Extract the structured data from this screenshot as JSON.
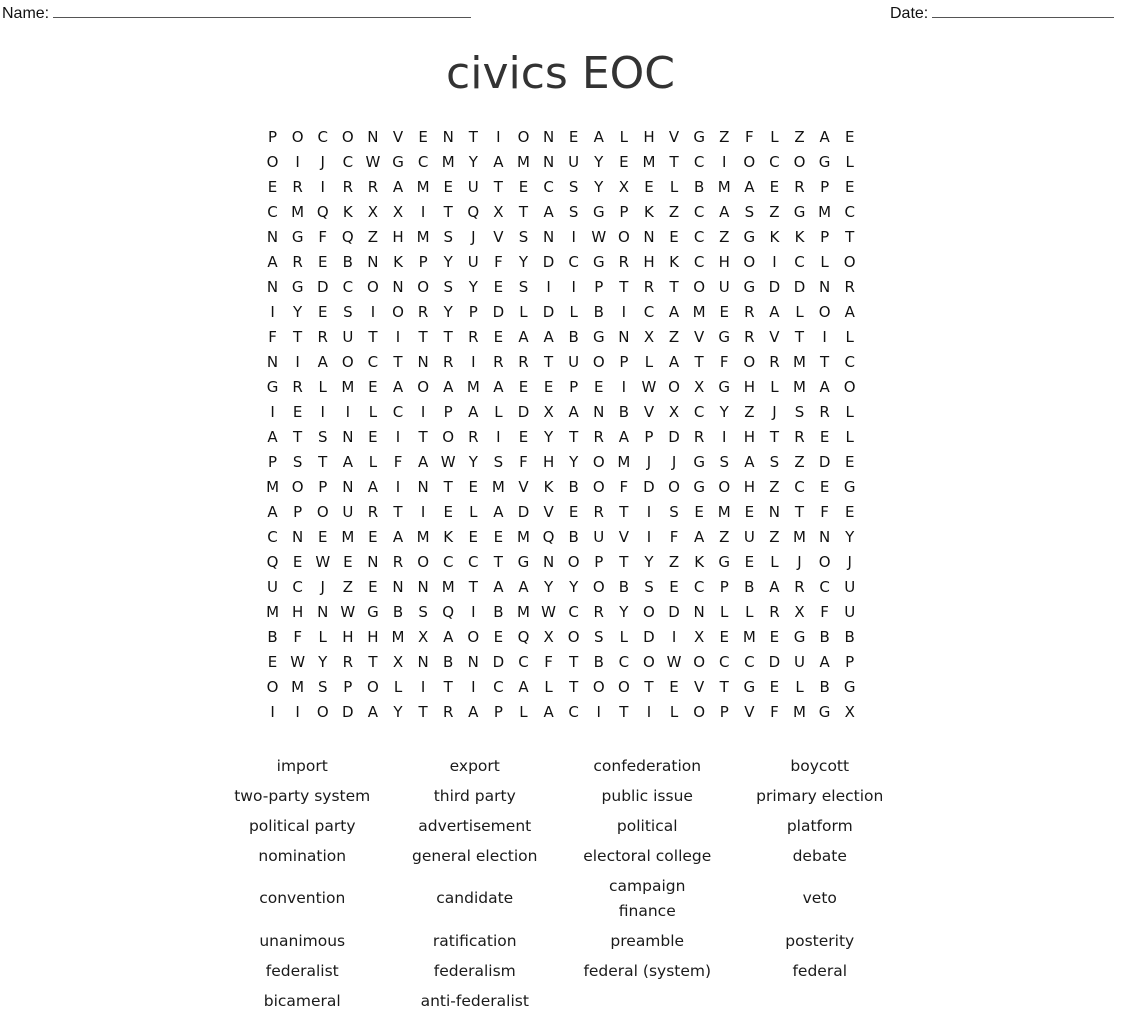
{
  "header": {
    "name_label": "Name:",
    "date_label": "Date:"
  },
  "title": "civics EOC",
  "grid": [
    [
      "P",
      "O",
      "C",
      "O",
      "N",
      "V",
      "E",
      "N",
      "T",
      "I",
      "O",
      "N",
      "E",
      "A",
      "L",
      "H",
      "V",
      "G",
      "Z",
      "F",
      "L",
      "Z",
      "A",
      "E"
    ],
    [
      "O",
      "I",
      "J",
      "C",
      "W",
      "G",
      "C",
      "M",
      "Y",
      "A",
      "M",
      "N",
      "U",
      "Y",
      "E",
      "M",
      "T",
      "C",
      "I",
      "O",
      "C",
      "O",
      "G",
      "L"
    ],
    [
      "E",
      "R",
      "I",
      "R",
      "R",
      "A",
      "M",
      "E",
      "U",
      "T",
      "E",
      "C",
      "S",
      "Y",
      "X",
      "E",
      "L",
      "B",
      "M",
      "A",
      "E",
      "R",
      "P",
      "E"
    ],
    [
      "C",
      "M",
      "Q",
      "K",
      "X",
      "X",
      "I",
      "T",
      "Q",
      "X",
      "T",
      "A",
      "S",
      "G",
      "P",
      "K",
      "Z",
      "C",
      "A",
      "S",
      "Z",
      "G",
      "M",
      "C"
    ],
    [
      "N",
      "G",
      "F",
      "Q",
      "Z",
      "H",
      "M",
      "S",
      "J",
      "V",
      "S",
      "N",
      "I",
      "W",
      "O",
      "N",
      "E",
      "C",
      "Z",
      "G",
      "K",
      "K",
      "P",
      "T"
    ],
    [
      "A",
      "R",
      "E",
      "B",
      "N",
      "K",
      "P",
      "Y",
      "U",
      "F",
      "Y",
      "D",
      "C",
      "G",
      "R",
      "H",
      "K",
      "C",
      "H",
      "O",
      "I",
      "C",
      "L",
      "O"
    ],
    [
      "N",
      "G",
      "D",
      "C",
      "O",
      "N",
      "O",
      "S",
      "Y",
      "E",
      "S",
      "I",
      "I",
      "P",
      "T",
      "R",
      "T",
      "O",
      "U",
      "G",
      "D",
      "D",
      "N",
      "R"
    ],
    [
      "I",
      "Y",
      "E",
      "S",
      "I",
      "O",
      "R",
      "Y",
      "P",
      "D",
      "L",
      "D",
      "L",
      "B",
      "I",
      "C",
      "A",
      "M",
      "E",
      "R",
      "A",
      "L",
      "O",
      "A"
    ],
    [
      "F",
      "T",
      "R",
      "U",
      "T",
      "I",
      "T",
      "T",
      "R",
      "E",
      "A",
      "A",
      "B",
      "G",
      "N",
      "X",
      "Z",
      "V",
      "G",
      "R",
      "V",
      "T",
      "I",
      "L"
    ],
    [
      "N",
      "I",
      "A",
      "O",
      "C",
      "T",
      "N",
      "R",
      "I",
      "R",
      "R",
      "T",
      "U",
      "O",
      "P",
      "L",
      "A",
      "T",
      "F",
      "O",
      "R",
      "M",
      "T",
      "C"
    ],
    [
      "G",
      "R",
      "L",
      "M",
      "E",
      "A",
      "O",
      "A",
      "M",
      "A",
      "E",
      "E",
      "P",
      "E",
      "I",
      "W",
      "O",
      "X",
      "G",
      "H",
      "L",
      "M",
      "A",
      "O"
    ],
    [
      "I",
      "E",
      "I",
      "I",
      "L",
      "C",
      "I",
      "P",
      "A",
      "L",
      "D",
      "X",
      "A",
      "N",
      "B",
      "V",
      "X",
      "C",
      "Y",
      "Z",
      "J",
      "S",
      "R",
      "L"
    ],
    [
      "A",
      "T",
      "S",
      "N",
      "E",
      "I",
      "T",
      "O",
      "R",
      "I",
      "E",
      "Y",
      "T",
      "R",
      "A",
      "P",
      "D",
      "R",
      "I",
      "H",
      "T",
      "R",
      "E",
      "L"
    ],
    [
      "P",
      "S",
      "T",
      "A",
      "L",
      "F",
      "A",
      "W",
      "Y",
      "S",
      "F",
      "H",
      "Y",
      "O",
      "M",
      "J",
      "J",
      "G",
      "S",
      "A",
      "S",
      "Z",
      "D",
      "E"
    ],
    [
      "M",
      "O",
      "P",
      "N",
      "A",
      "I",
      "N",
      "T",
      "E",
      "M",
      "V",
      "K",
      "B",
      "O",
      "F",
      "D",
      "O",
      "G",
      "O",
      "H",
      "Z",
      "C",
      "E",
      "G"
    ],
    [
      "A",
      "P",
      "O",
      "U",
      "R",
      "T",
      "I",
      "E",
      "L",
      "A",
      "D",
      "V",
      "E",
      "R",
      "T",
      "I",
      "S",
      "E",
      "M",
      "E",
      "N",
      "T",
      "F",
      "E"
    ],
    [
      "C",
      "N",
      "E",
      "M",
      "E",
      "A",
      "M",
      "K",
      "E",
      "E",
      "M",
      "Q",
      "B",
      "U",
      "V",
      "I",
      "F",
      "A",
      "Z",
      "U",
      "Z",
      "M",
      "N",
      "Y"
    ],
    [
      "Q",
      "E",
      "W",
      "E",
      "N",
      "R",
      "O",
      "C",
      "C",
      "T",
      "G",
      "N",
      "O",
      "P",
      "T",
      "Y",
      "Z",
      "K",
      "G",
      "E",
      "L",
      "J",
      "O",
      "J"
    ],
    [
      "U",
      "C",
      "J",
      "Z",
      "E",
      "N",
      "N",
      "M",
      "T",
      "A",
      "A",
      "Y",
      "Y",
      "O",
      "B",
      "S",
      "E",
      "C",
      "P",
      "B",
      "A",
      "R",
      "C",
      "U"
    ],
    [
      "M",
      "H",
      "N",
      "W",
      "G",
      "B",
      "S",
      "Q",
      "I",
      "B",
      "M",
      "W",
      "C",
      "R",
      "Y",
      "O",
      "D",
      "N",
      "L",
      "L",
      "R",
      "X",
      "F",
      "U"
    ],
    [
      "B",
      "F",
      "L",
      "H",
      "H",
      "M",
      "X",
      "A",
      "O",
      "E",
      "Q",
      "X",
      "O",
      "S",
      "L",
      "D",
      "I",
      "X",
      "E",
      "M",
      "E",
      "G",
      "B",
      "B"
    ],
    [
      "E",
      "W",
      "Y",
      "R",
      "T",
      "X",
      "N",
      "B",
      "N",
      "D",
      "C",
      "F",
      "T",
      "B",
      "C",
      "O",
      "W",
      "O",
      "C",
      "C",
      "D",
      "U",
      "A",
      "P"
    ],
    [
      "O",
      "M",
      "S",
      "P",
      "O",
      "L",
      "I",
      "T",
      "I",
      "C",
      "A",
      "L",
      "T",
      "O",
      "O",
      "T",
      "E",
      "V",
      "T",
      "G",
      "E",
      "L",
      "B",
      "G"
    ],
    [
      "I",
      "I",
      "O",
      "D",
      "A",
      "Y",
      "T",
      "R",
      "A",
      "P",
      "L",
      "A",
      "C",
      "I",
      "T",
      "I",
      "L",
      "O",
      "P",
      "V",
      "F",
      "M",
      "G",
      "X"
    ]
  ],
  "word_list": [
    [
      "import",
      "export",
      "confederation",
      "boycott"
    ],
    [
      "two-party system",
      "third party",
      "public issue",
      "primary election"
    ],
    [
      "political party",
      "advertisement",
      "political",
      "platform"
    ],
    [
      "nomination",
      "general election",
      "electoral college",
      "debate"
    ],
    [
      "convention",
      "candidate",
      "campaign\nfinance",
      "veto"
    ],
    [
      "unanimous",
      "ratification",
      "preamble",
      "posterity"
    ],
    [
      "federalist",
      "federalism",
      "federal (system)",
      "federal"
    ],
    [
      "bicameral",
      "anti-federalist"
    ]
  ]
}
